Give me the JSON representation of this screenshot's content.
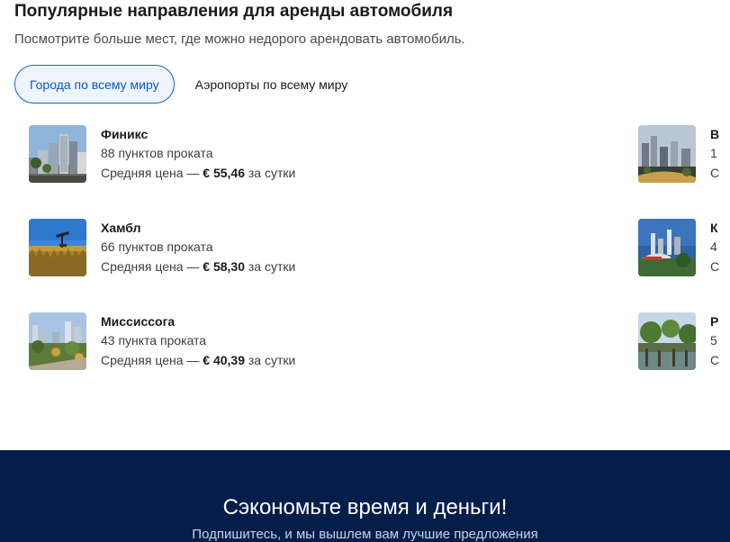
{
  "header": {
    "title": "Популярные направления для аренды автомобиля",
    "subtitle": "Посмотрите больше мест, где можно недорого арендовать автомобиль."
  },
  "tabs": [
    {
      "label": "Города по всему миру",
      "active": true
    },
    {
      "label": "Аэропорты по всему миру",
      "active": false
    }
  ],
  "destinations": [
    {
      "city": "Финикс",
      "locations": "88 пунктов проката",
      "price_prefix": "Средняя цена — ",
      "price": "€ 55,46",
      "price_suffix": " за сутки",
      "image": "city-skyline"
    },
    {
      "city": "Хамбл",
      "locations": "66 пунктов проката",
      "price_prefix": "Средняя цена — ",
      "price": "€ 58,30",
      "price_suffix": " за сутки",
      "image": "oil-field"
    },
    {
      "city": "Миссиссога",
      "locations": "43 пункта проката",
      "price_prefix": "Средняя цена — ",
      "price": "€ 40,39",
      "price_suffix": " за сутки",
      "image": "suburb-park"
    }
  ],
  "destinations_right": [
    {
      "city": "В",
      "locations": "1",
      "price_prefix": "С"
    },
    {
      "city": "К",
      "locations": "4",
      "price_prefix": "С"
    },
    {
      "city": "Р",
      "locations": "5",
      "price_prefix": "С"
    }
  ],
  "footer": {
    "title": "Сэкономьте время и деньги!",
    "subtitle": "Подпишитесь, и мы вышлем вам лучшие предложения"
  },
  "colors": {
    "accent": "#0a66d8",
    "active_tab_bg": "#eef4fd",
    "footer_bg": "#041e4a"
  }
}
